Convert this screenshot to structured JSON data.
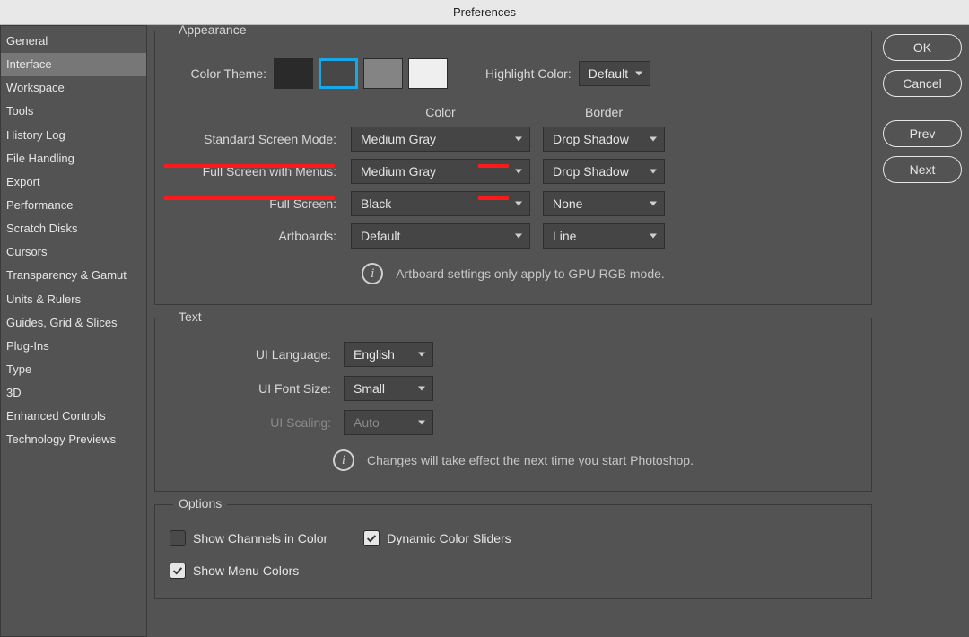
{
  "window": {
    "title": "Preferences"
  },
  "sidebar": {
    "items": [
      "General",
      "Interface",
      "Workspace",
      "Tools",
      "History Log",
      "File Handling",
      "Export",
      "Performance",
      "Scratch Disks",
      "Cursors",
      "Transparency & Gamut",
      "Units & Rulers",
      "Guides, Grid & Slices",
      "Plug-Ins",
      "Type",
      "3D",
      "Enhanced Controls",
      "Technology Previews"
    ],
    "selected_index": 1
  },
  "buttons": {
    "ok": "OK",
    "cancel": "Cancel",
    "prev": "Prev",
    "next": "Next"
  },
  "appearance": {
    "legend": "Appearance",
    "color_theme_label": "Color Theme:",
    "swatches": [
      "#2a2a2a",
      "#474747",
      "#848484",
      "#efefef"
    ],
    "swatch_selected_index": 1,
    "highlight_color_label": "Highlight Color:",
    "highlight_color_value": "Default",
    "columns": {
      "color": "Color",
      "border": "Border"
    },
    "rows": {
      "standard": {
        "label": "Standard Screen Mode:",
        "color": "Medium Gray",
        "border": "Drop Shadow"
      },
      "fullmenus": {
        "label": "Full Screen with Menus:",
        "color": "Medium Gray",
        "border": "Drop Shadow"
      },
      "fullscreen": {
        "label": "Full Screen:",
        "color": "Black",
        "border": "None"
      },
      "artboards": {
        "label": "Artboards:",
        "color": "Default",
        "border": "Line"
      }
    },
    "info": "Artboard settings only apply to GPU RGB mode."
  },
  "text": {
    "legend": "Text",
    "ui_language_label": "UI Language:",
    "ui_language_value": "English",
    "ui_font_size_label": "UI Font Size:",
    "ui_font_size_value": "Small",
    "ui_scaling_label": "UI Scaling:",
    "ui_scaling_value": "Auto",
    "info": "Changes will take effect the next time you start Photoshop."
  },
  "options": {
    "legend": "Options",
    "show_channels": {
      "label": "Show Channels in Color",
      "checked": false
    },
    "dynamic_sliders": {
      "label": "Dynamic Color Sliders",
      "checked": true
    },
    "show_menu_colors": {
      "label": "Show Menu Colors",
      "checked": true
    }
  }
}
